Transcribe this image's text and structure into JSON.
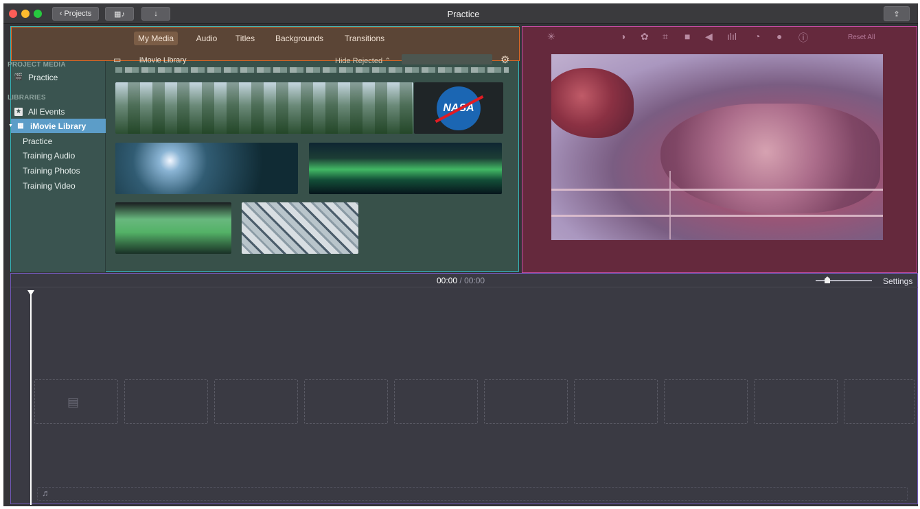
{
  "window": {
    "title": "Practice",
    "projects_button": "Projects"
  },
  "browser": {
    "tabs": [
      "My Media",
      "Audio",
      "Titles",
      "Backgrounds",
      "Transitions"
    ],
    "active_tab": "My Media",
    "library_title": "iMovie Library",
    "hide_rejected": "Hide Rejected",
    "search_placeholder": ""
  },
  "sidebar": {
    "project_media_label": "PROJECT MEDIA",
    "project_item": "Practice",
    "libraries_label": "LIBRARIES",
    "all_events": "All Events",
    "library": "iMovie Library",
    "events": [
      "Practice",
      "Training Audio",
      "Training Photos",
      "Training Video"
    ]
  },
  "clips": {
    "nasa_logo": "NASA"
  },
  "viewer": {
    "reset_all": "Reset All",
    "tools": [
      "magic-wand-icon",
      "color-balance-icon",
      "palette-icon",
      "crop-icon",
      "camera-icon",
      "volume-icon",
      "equalizer-icon",
      "speed-icon",
      "filter-icon",
      "info-icon"
    ]
  },
  "timeline": {
    "current_time": "00:00",
    "separator": "/",
    "total_time": "00:00",
    "settings": "Settings"
  },
  "colors": {
    "browser_overlay": "#38514a",
    "toolbar_overlay": "#5b4536",
    "viewer_overlay": "#65293d",
    "timeline_overlay": "#3a3a43",
    "selection": "#5c9dc8"
  }
}
